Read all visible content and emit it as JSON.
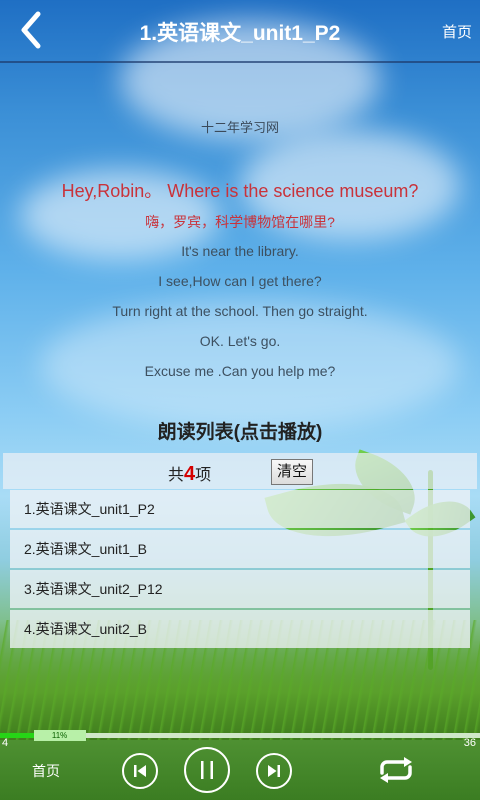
{
  "header": {
    "title": "1.英语课文_unit1_P2",
    "home_label": "首页",
    "back_icon": "chevron-left-icon"
  },
  "lyrics": {
    "source": "十二年学习网",
    "active_en": "Hey,Robin。 Where is the science museum?",
    "active_cn": "嗨，罗宾，科学博物馆在哪里?",
    "lines": [
      "It's near the library.",
      "I see,How can I get there?",
      "Turn right at the school. Then go straight.",
      "OK. Let's go.",
      "Excuse me .Can you help me?"
    ]
  },
  "playlist": {
    "title": "朗读列表(点击播放)",
    "count_prefix": "共",
    "count": "4",
    "count_suffix": "项",
    "clear_label": "清空",
    "items": [
      "1.英语课文_unit1_P2",
      "2.英语课文_unit1_B",
      "3.英语课文_unit2_P12",
      "4.英语课文_unit2_B"
    ]
  },
  "progress": {
    "percent_label": "11%",
    "percent": 11,
    "current": "4",
    "total": "36"
  },
  "controls": {
    "home_label": "首页",
    "prev_icon": "skip-previous-icon",
    "pause_icon": "pause-icon",
    "next_icon": "skip-next-icon",
    "repeat_icon": "repeat-icon"
  },
  "colors": {
    "highlight": "#c9323a",
    "count": "#d40000",
    "progress": "#26d416"
  }
}
